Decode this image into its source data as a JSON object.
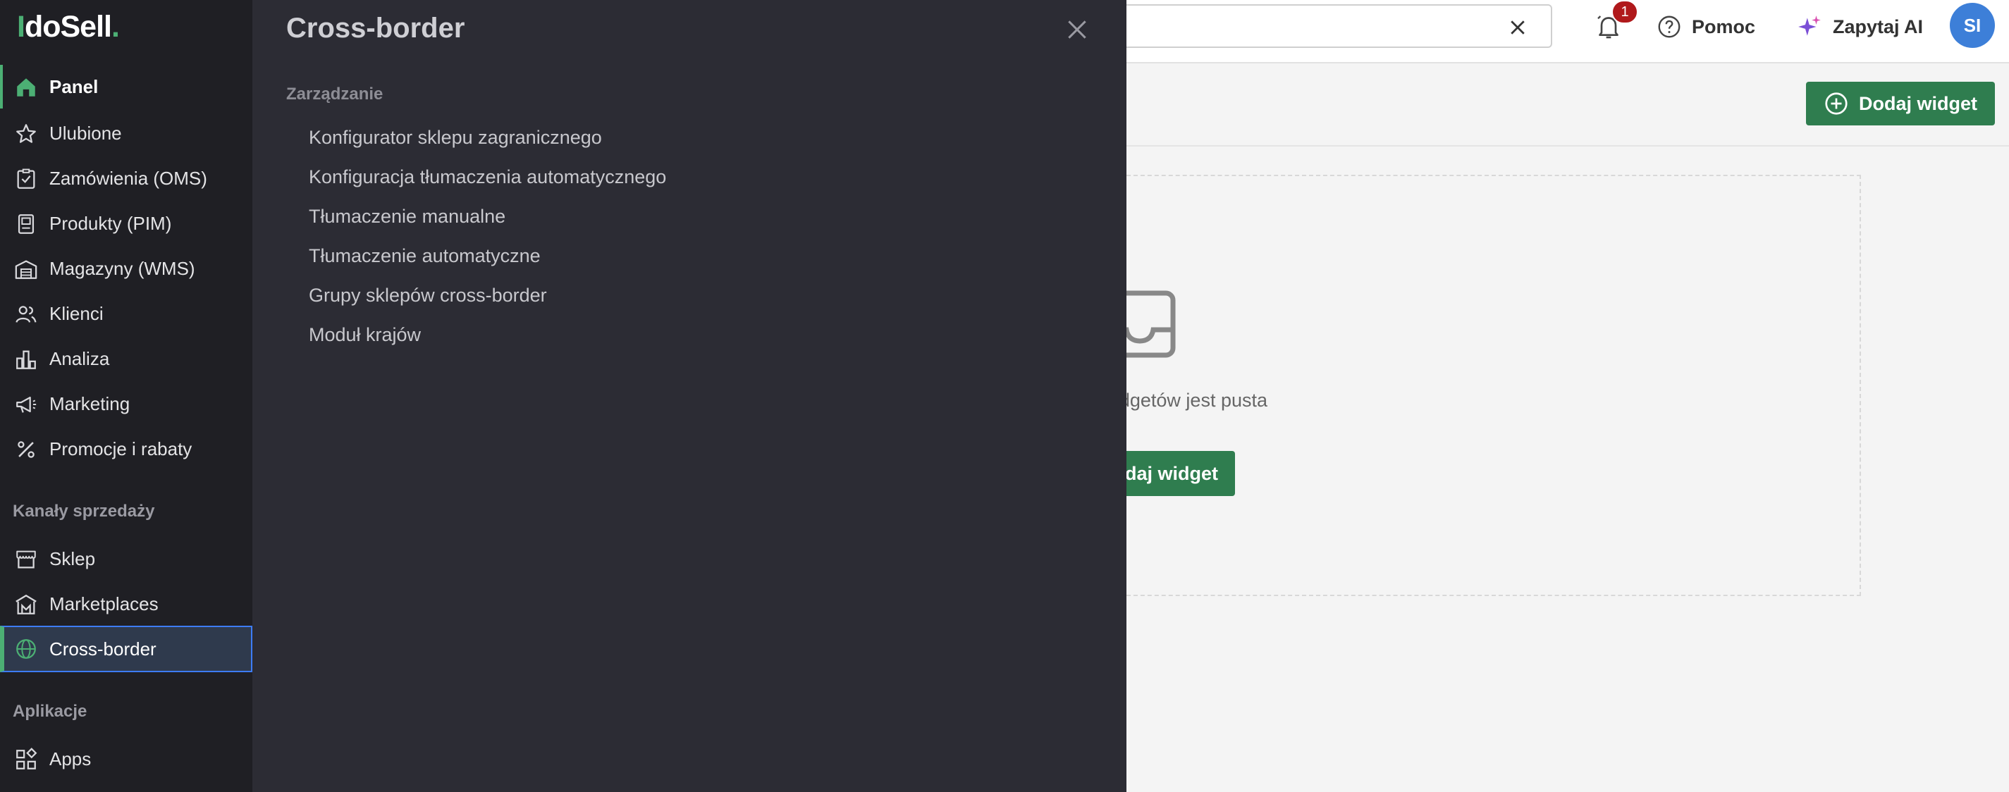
{
  "brand": {
    "logo_green": "I",
    "logo_white": "doSell",
    "logo_dot": "."
  },
  "sidebar": {
    "items": [
      {
        "label": "Panel"
      },
      {
        "label": "Ulubione"
      },
      {
        "label": "Zamówienia (OMS)"
      },
      {
        "label": "Produkty (PIM)"
      },
      {
        "label": "Magazyny (WMS)"
      },
      {
        "label": "Klienci"
      },
      {
        "label": "Analiza"
      },
      {
        "label": "Marketing"
      },
      {
        "label": "Promocje i rabaty"
      }
    ],
    "sales_section": "Kanały sprzedaży",
    "sales_items": [
      {
        "label": "Sklep"
      },
      {
        "label": "Marketplaces"
      },
      {
        "label": "Cross-border"
      }
    ],
    "apps_section": "Aplikacje",
    "apps_items": [
      {
        "label": "Apps"
      }
    ]
  },
  "drawer": {
    "title": "Cross-border",
    "section": "Zarządzanie",
    "links": [
      "Konfigurator sklepu zagranicznego",
      "Konfiguracja tłumaczenia automatycznego",
      "Tłumaczenie manualne",
      "Tłumaczenie automatyczne",
      "Grupy sklepów cross-border",
      "Moduł krajów"
    ]
  },
  "topbar": {
    "notifications_count": "1",
    "help_label": "Pomoc",
    "ai_label": "Zapytaj AI",
    "avatar_initials": "SI"
  },
  "dashboard": {
    "add_widget_label": "Dodaj widget",
    "empty_text_visible": "dgetów jest pusta",
    "empty_button_visible": "daj widget"
  },
  "colors": {
    "accent_green": "#2f7d4f",
    "brand_green": "#4caf74",
    "badge_red": "#b0191b",
    "avatar_blue": "#3d7fd8"
  }
}
